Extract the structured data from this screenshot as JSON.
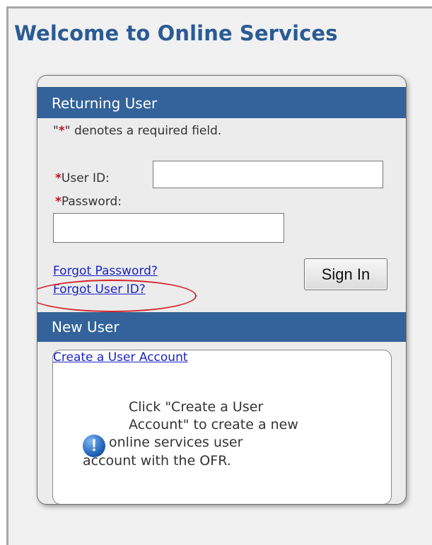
{
  "page": {
    "title": "Welcome to Online Services"
  },
  "returning": {
    "header": "Returning User",
    "required_note_quote_open": "\"",
    "required_note_star": "*",
    "required_note_rest": "\" denotes a required field.",
    "userid_star": "*",
    "userid_label": "User ID:",
    "userid_value": "",
    "password_star": "*",
    "password_label": "Password:",
    "password_value": "",
    "forgot_password": "Forgot Password?",
    "forgot_userid": "Forgot User ID?",
    "signin": "Sign In"
  },
  "newuser": {
    "header": "New User",
    "create_link": "Create a User Account",
    "info_line1": "Click \"Create a User",
    "info_line2": "Account\" to create a new",
    "info_line3": "online services user",
    "info_line4": "account with the OFR.",
    "info_icon": "info-exclamation-icon"
  },
  "colors": {
    "header_bar": "#33639a",
    "title": "#2b5b94",
    "link": "#1b23c8",
    "required_star": "#c0131b",
    "annotation_oval": "#d3242b"
  }
}
